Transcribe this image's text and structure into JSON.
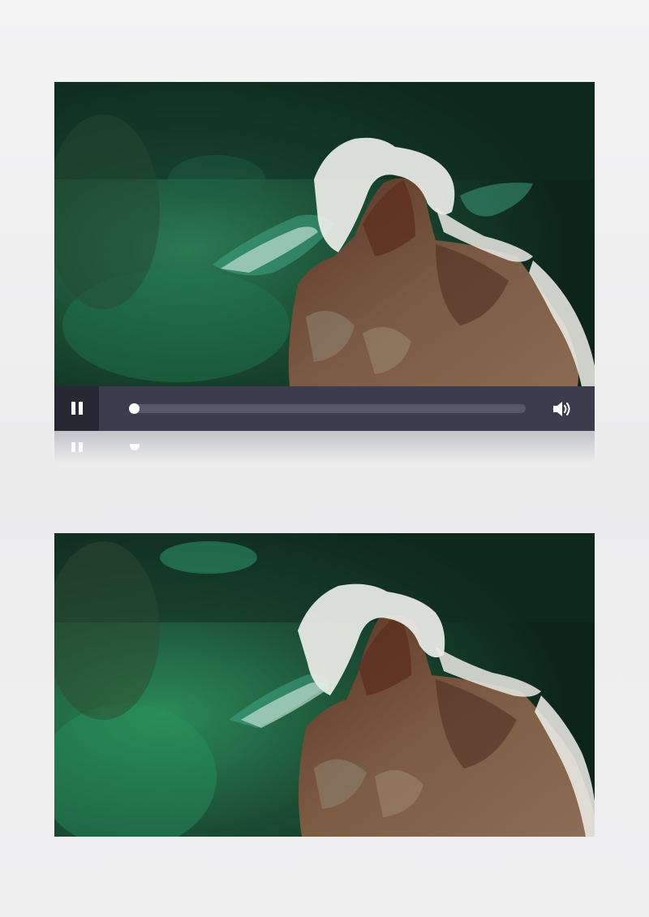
{
  "player": {
    "progress": 0.0,
    "state": "playing",
    "pause_icon": "pause-icon",
    "volume_icon": "speaker-volume-icon"
  },
  "colors": {
    "page_background": "#eeeeef",
    "control_bar": "#3b3d4c",
    "pause_button_bg": "#262833",
    "track": "#565869",
    "thumb": "#ffffff",
    "sea_dark": "#0f2a1e",
    "sea_green": "#1e6b47",
    "rock": "#6b4a33",
    "foam": "#f2f2ee"
  }
}
